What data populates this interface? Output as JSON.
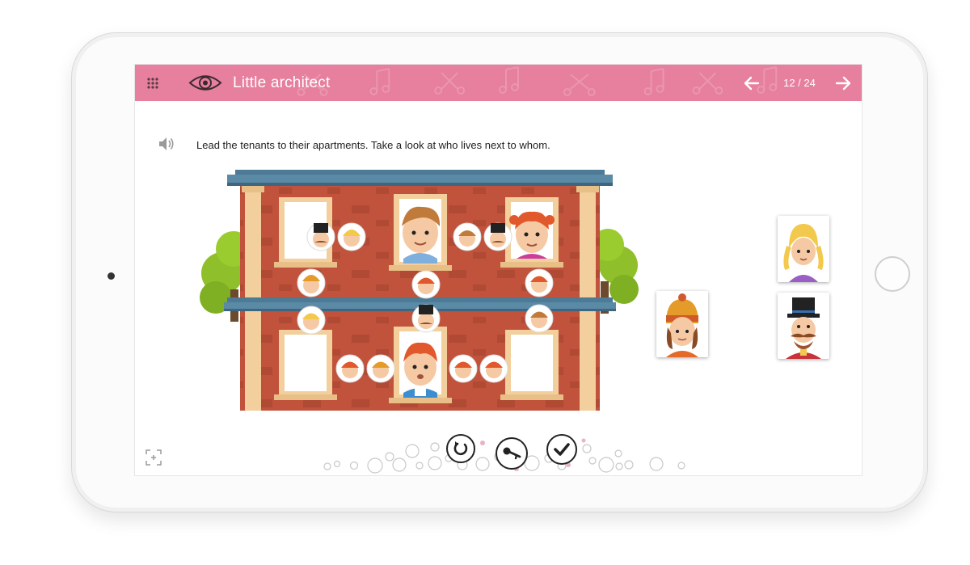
{
  "header": {
    "title": "Little architect",
    "page_counter": "12 / 24",
    "icons": [
      "grid-menu-icon",
      "eye-icon",
      "arrow-left-icon",
      "arrow-right-icon"
    ]
  },
  "instruction": {
    "text": "Lead the tenants to their apartments. Take a look at who lives next to whom.",
    "icon": "speaker-icon"
  },
  "building": {
    "floors": 2,
    "windows_per_floor": 3,
    "occupied_windows": [
      {
        "floor": "top",
        "position": "middle",
        "tenant": "brown-haired boy"
      },
      {
        "floor": "top",
        "position": "right",
        "tenant": "red-haired girl"
      },
      {
        "floor": "bottom",
        "position": "middle",
        "tenant": "red-haired boy"
      }
    ]
  },
  "tenant_cards": [
    {
      "name": "girl-beanie-card"
    },
    {
      "name": "blonde-girl-card"
    },
    {
      "name": "top-hat-man-card"
    }
  ],
  "controls": {
    "icons": [
      "reset-icon",
      "key-icon",
      "check-icon"
    ]
  },
  "colors": {
    "header": "#e77f9e",
    "brick": "#c1523b",
    "frame": "#f2cf9c",
    "roof": "#4d7a95",
    "tree": "#8fbf2a"
  }
}
